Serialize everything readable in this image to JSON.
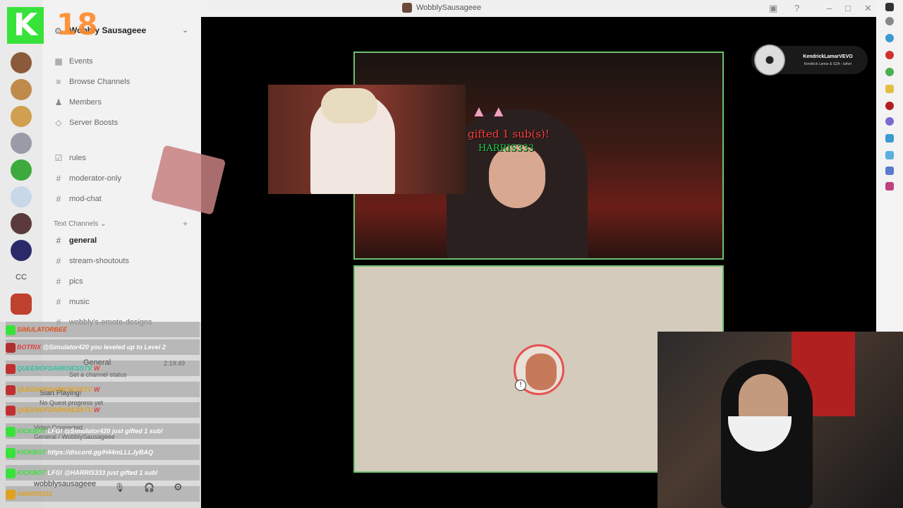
{
  "window": {
    "title": "WobblySausageee"
  },
  "overlay": {
    "logo_k": "K",
    "logo_18": "18"
  },
  "sidebar": {
    "server_name": "Wobbly Sausageee",
    "nav": [
      {
        "label": "Events",
        "icon": "calendar-icon"
      },
      {
        "label": "Browse Channels",
        "icon": "list-icon"
      },
      {
        "label": "Members",
        "icon": "members-icon"
      },
      {
        "label": "Server Boosts",
        "icon": "boost-icon"
      }
    ],
    "channels_top": [
      "rules",
      "moderator-only",
      "mod-chat"
    ],
    "category": "Text Channels",
    "text_channels": [
      "general",
      "stream-shoutouts",
      "pics",
      "music",
      "wobbly's-emote-designs"
    ],
    "voice_channel": "General",
    "voice_status": "Set a channel status",
    "voice_time": "2:19:49",
    "quest_title": "Start Playing!",
    "quest_sub": "No Quest progress yet",
    "video_connected": "Video Connected",
    "video_connected_sub": "General / WobblySausageee",
    "user_name": "wobblysausageee"
  },
  "rail": {
    "cc_label": "CC"
  },
  "chat": [
    {
      "user": "SIMULATORBEE",
      "msg": ""
    },
    {
      "user": "BOTRIX",
      "msg": "@Simulator420 you leveled up to Level 2"
    },
    {
      "user": "QUEENOFDARKNESSTV",
      "msg": "W"
    },
    {
      "user": "QUEENOFDARKNESSTV",
      "msg": "W"
    },
    {
      "user": "QUEENOFDARKNESSTV",
      "msg": "W"
    },
    {
      "user": "KICKBOT",
      "msg": "LFG! @Simulator420 just gifted 1 sub!"
    },
    {
      "user": "KICKBOT",
      "msg": "https://discord.gg/H44mLLLJyBAQ"
    },
    {
      "user": "KICKBOT",
      "msg": "LFG! @HARRIS333 just gifted 1 sub!"
    },
    {
      "user": "HARRIS333",
      "msg": ""
    }
  ],
  "stream": {
    "gift_text": "gifted 1 sub(s)!",
    "gift_user": "HARRIS333"
  },
  "now_playing": {
    "artist": "KendrickLamarVEVO",
    "track": "Kendrick Lamar & SZA - luther"
  },
  "colors": {
    "accent_green": "#37e23a",
    "frame_border": "#6fbf6f",
    "chat_user_green": "#1fd14a"
  }
}
